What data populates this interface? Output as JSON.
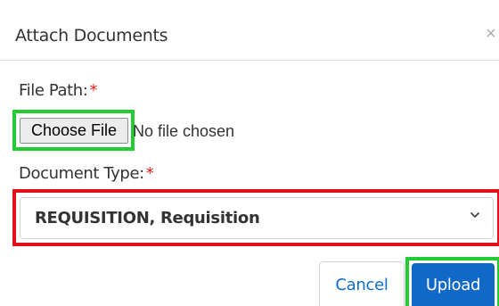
{
  "modal": {
    "title": "Attach Documents",
    "close_symbol": "×"
  },
  "file_path": {
    "label": "File Path:",
    "required_marker": "*",
    "choose_button_label": "Choose File",
    "status_text": "No file chosen"
  },
  "document_type": {
    "label": "Document Type:",
    "required_marker": "*",
    "selected_value": "REQUISITION, Requisition"
  },
  "actions": {
    "cancel_label": "Cancel",
    "upload_label": "Upload"
  },
  "icons": {
    "close": "close-icon",
    "dropdown": "chevron-down-icon"
  },
  "colors": {
    "required": "#e01b1b",
    "primary": "#1068c7",
    "highlight_green": "#22cc33",
    "highlight_red": "#e0131a"
  }
}
